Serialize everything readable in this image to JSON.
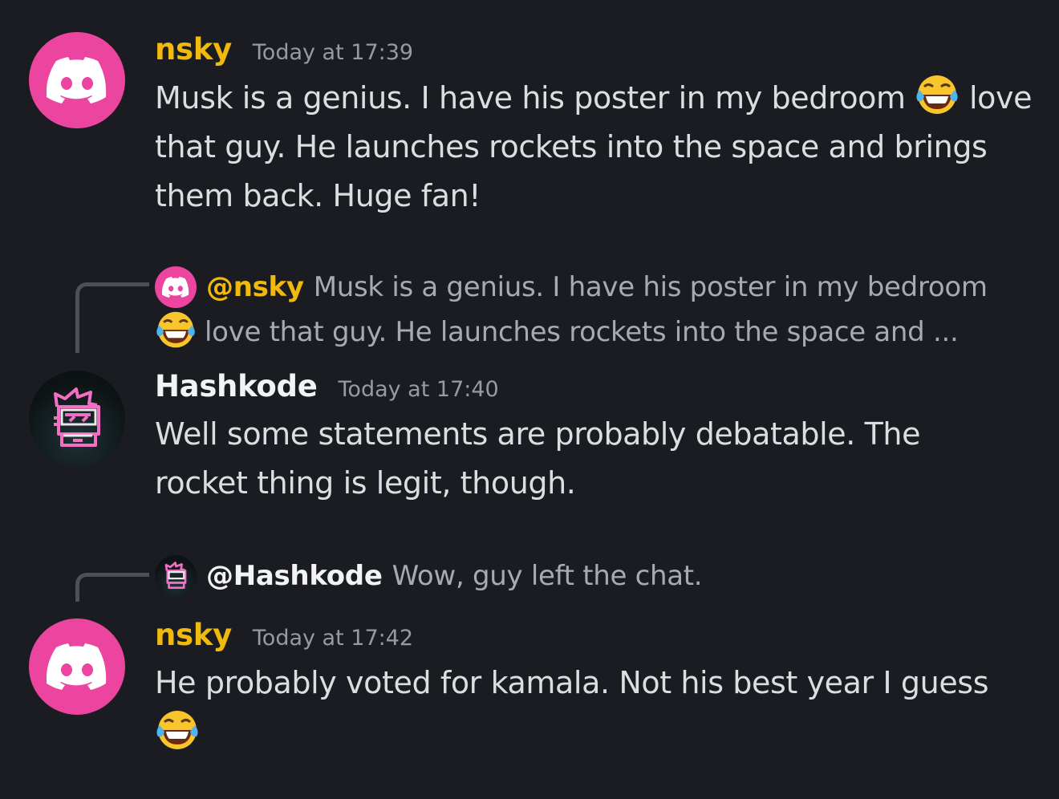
{
  "messages": [
    {
      "author": "nsky",
      "time": "Today at 17:39",
      "text_1": "Musk is a genius. I have his poster in my bedroom",
      "emoji": "tears-of-joy-emoji",
      "text_2": "love that guy. He launches rockets into the space and brings them back. Huge fan!"
    },
    {
      "reply": {
        "mention": "@nsky",
        "preview_1": "Musk is a genius. I have his poster in my bedroom",
        "preview_2": "love that guy. He launches rockets into the space and ..."
      },
      "author": "Hashkode",
      "time": "Today at 17:40",
      "text": "Well some statements are probably debatable. The rocket thing is legit, though."
    },
    {
      "reply": {
        "mention": "@Hashkode",
        "preview": "Wow, guy left the chat."
      },
      "author": "nsky",
      "time": "Today at 17:42",
      "text": "He probably voted for kamala. Not his best year I guess"
    }
  ],
  "colors": {
    "background": "#1b1c21",
    "nsky_name": "#f0b90c",
    "hashkode_name": "#f2f3f5",
    "discord_avatar": "#eb459f",
    "timestamp": "#949ba4"
  }
}
